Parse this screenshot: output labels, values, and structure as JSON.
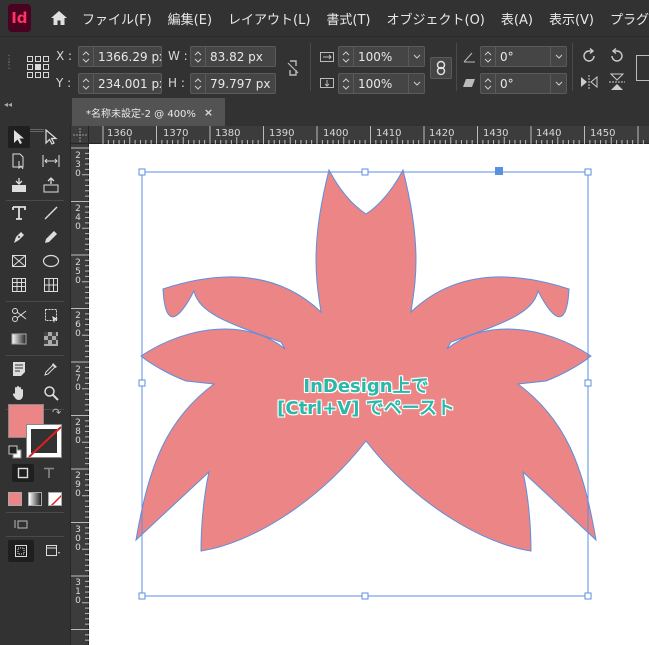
{
  "app": {
    "logo_text": "Id"
  },
  "menu": [
    "ファイル(F)",
    "編集(E)",
    "レイアウト(L)",
    "書式(T)",
    "オブジェクト(O)",
    "表(A)",
    "表示(V)",
    "プラグ"
  ],
  "control": {
    "x_label": "X :",
    "x_value": "1366.29 px",
    "y_label": "Y :",
    "y_value": "234.001 px",
    "w_label": "W :",
    "w_value": "83.82 px",
    "h_label": "H :",
    "h_value": "79.797 px",
    "scale_x": "100%",
    "scale_y": "100%",
    "rotate": "0°",
    "shear": "0°"
  },
  "tab": {
    "label": "*名称未設定-2 @ 400%",
    "close": "×"
  },
  "ruler": {
    "top_labels": [
      "1360",
      "1370",
      "1380",
      "1390",
      "1400",
      "1410",
      "1420",
      "1430",
      "1440",
      "1450"
    ],
    "left_labels": [
      [
        "2",
        "3",
        "0"
      ],
      [
        "2",
        "4",
        "0"
      ],
      [
        "2",
        "5",
        "0"
      ],
      [
        "2",
        "6",
        "0"
      ],
      [
        "2",
        "7",
        "0"
      ],
      [
        "2",
        "8",
        "0"
      ],
      [
        "2",
        "9",
        "0"
      ],
      [
        "3",
        "0",
        "0"
      ],
      [
        "3",
        "1",
        "0"
      ]
    ]
  },
  "canvas": {
    "caption_line1": "InDesign上で",
    "caption_line2": "[Ctrl+V] でペースト",
    "fill_color": "#ec8585",
    "stroke_color": "#5b8fe0",
    "text_color": "#2ab8a8"
  },
  "colors": {
    "fill_swatch": "#ec8585",
    "panel_bg": "#323232"
  }
}
